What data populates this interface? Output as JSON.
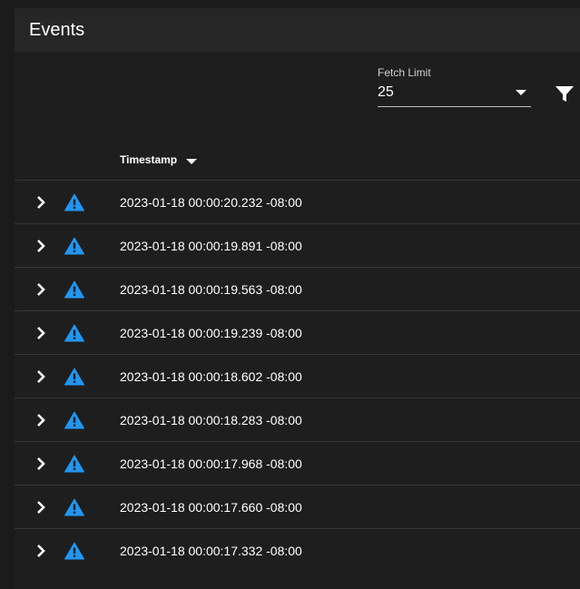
{
  "header": {
    "title": "Events"
  },
  "fetch_limit": {
    "label": "Fetch Limit",
    "value": "25"
  },
  "table": {
    "columns": [
      {
        "label": "Timestamp",
        "sort": "descending"
      }
    ],
    "rows": [
      {
        "severity": "warning",
        "timestamp": "2023-01-18 00:00:20.232 -08:00"
      },
      {
        "severity": "warning",
        "timestamp": "2023-01-18 00:00:19.891 -08:00"
      },
      {
        "severity": "warning",
        "timestamp": "2023-01-18 00:00:19.563 -08:00"
      },
      {
        "severity": "warning",
        "timestamp": "2023-01-18 00:00:19.239 -08:00"
      },
      {
        "severity": "warning",
        "timestamp": "2023-01-18 00:00:18.602 -08:00"
      },
      {
        "severity": "warning",
        "timestamp": "2023-01-18 00:00:18.283 -08:00"
      },
      {
        "severity": "warning",
        "timestamp": "2023-01-18 00:00:17.968 -08:00"
      },
      {
        "severity": "warning",
        "timestamp": "2023-01-18 00:00:17.660 -08:00"
      },
      {
        "severity": "warning",
        "timestamp": "2023-01-18 00:00:17.332 -08:00"
      }
    ]
  },
  "icons": {
    "filter": "filter-icon",
    "dropdown": "caret-down-icon",
    "sort": "sort-descending-icon",
    "expand": "chevron-right-icon",
    "severity": "warning-triangle-icon"
  },
  "colors": {
    "background": "#1b1b1b",
    "panel": "#1e1e1e",
    "header": "#262626",
    "warning_icon": "#2196f3",
    "divider": "#363636"
  }
}
